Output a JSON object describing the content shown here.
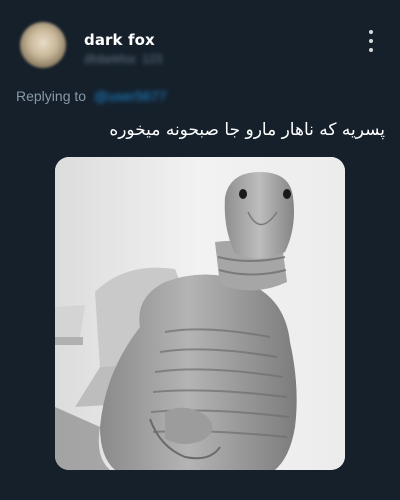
{
  "tweet": {
    "display_name": "dark fox",
    "handle": "@darkfox_123",
    "replying_prefix": "Replying to",
    "replying_handle": "@user5677",
    "text": "پسریه که ناهار مارو جا صبحونه میخوره"
  },
  "colors": {
    "background": "#15202b",
    "secondary_text": "#8899a6",
    "link": "#1d9bf0"
  },
  "icons": {
    "more": "more-vertical-icon"
  }
}
